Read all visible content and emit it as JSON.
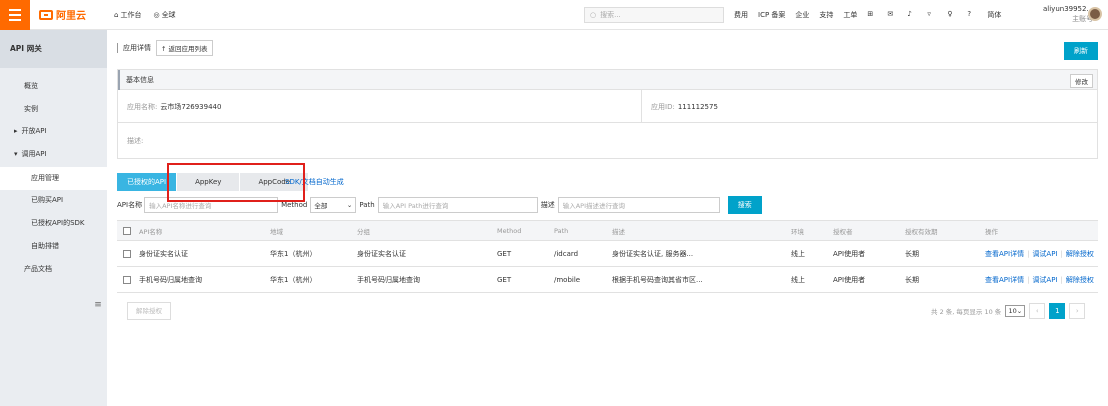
{
  "topbar": {
    "logo": "阿里云",
    "workbench": "工作台",
    "global": "全球",
    "search_placeholder": "搜索...",
    "links": [
      "费用",
      "ICP 备案",
      "企业",
      "支持",
      "工单"
    ],
    "lang": "简体",
    "username": "aliyun39952...",
    "account_type": "主账号"
  },
  "sidebar": {
    "title": "API 网关",
    "items": [
      {
        "label": "概览"
      },
      {
        "label": "实例"
      },
      {
        "label": "开放API",
        "arrow": "▸"
      },
      {
        "label": "调用API",
        "arrow": "▾"
      },
      {
        "label": "应用管理"
      },
      {
        "label": "已购买API"
      },
      {
        "label": "已授权API的SDK"
      },
      {
        "label": "自助排错"
      },
      {
        "label": "产品文档"
      }
    ]
  },
  "header": {
    "title": "应用详情",
    "back_label": "返回应用列表",
    "refresh_label": "刷新"
  },
  "info": {
    "section_title": "基本信息",
    "edit_label": "修改",
    "app_name_label": "应用名称:",
    "app_name_value": "云市场726939440",
    "app_id_label": "应用ID:",
    "app_id_value": "111112575",
    "desc_label": "描述:"
  },
  "tabs": [
    {
      "label": "已授权的API"
    },
    {
      "label": "AppKey"
    },
    {
      "label": "AppCode"
    }
  ],
  "sdk_link": "SDK/文档自动生成",
  "filter": {
    "api_name_label": "API名称",
    "api_name_placeholder": "输入API名称进行查询",
    "method_label": "Method",
    "method_value": "全部",
    "path_label": "Path",
    "path_placeholder": "输入API Path进行查询",
    "desc_label": "描述",
    "desc_placeholder": "输入API描述进行查询",
    "search_label": "搜索"
  },
  "table": {
    "headers": [
      "API名称",
      "地域",
      "分组",
      "Method",
      "Path",
      "描述",
      "环境",
      "授权者",
      "授权有效期",
      "操作"
    ],
    "rows": [
      {
        "name": "身份证实名认证",
        "region": "华东1（杭州）",
        "group": "身份证实名认证",
        "method": "GET",
        "path": "/idcard",
        "desc": "身份证实名认证, 服务器...",
        "env": "线上",
        "grantee": "API使用者",
        "validity": "长期",
        "ops": [
          "查看API详情",
          "调试API",
          "解除授权"
        ]
      },
      {
        "name": "手机号码归属地查询",
        "region": "华东1（杭州）",
        "group": "手机号码归属地查询",
        "method": "GET",
        "path": "/mobile",
        "desc": "根据手机号码查询其省市区...",
        "env": "线上",
        "grantee": "API使用者",
        "validity": "长期",
        "ops": [
          "查看API详情",
          "调试API",
          "解除授权"
        ]
      }
    ]
  },
  "footer": {
    "revoke_label": "解除授权",
    "summary": "共 2 条, 每页显示 10 条",
    "page_size": "10",
    "current_page": "1"
  },
  "colors": {
    "brand": "#ff6a00",
    "primary": "#00a2ca",
    "tab_active": "#39b5e2",
    "highlight": "#e0201b"
  }
}
